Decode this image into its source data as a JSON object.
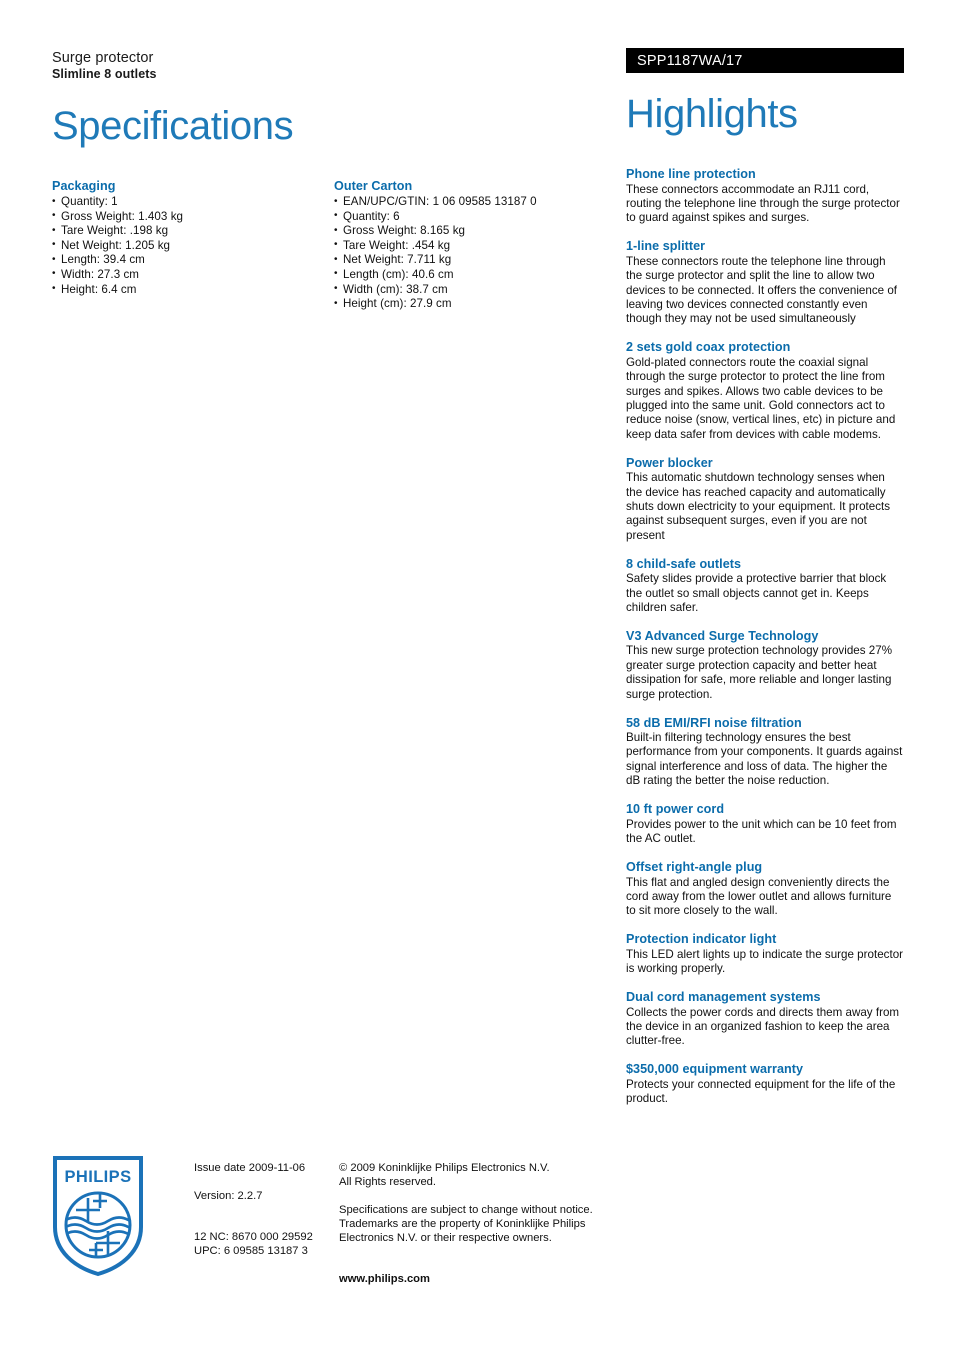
{
  "header": {
    "product_name": "Surge protector",
    "product_sub": "Slimline 8 outlets",
    "product_code": "SPP1187WA/17",
    "spec_title": "Specifications",
    "highlights_title": "Highlights"
  },
  "specifications": {
    "groups": [
      {
        "heading": "Packaging",
        "items": [
          "Quantity: 1",
          "Gross Weight: 1.403 kg",
          "Tare Weight: .198 kg",
          "Net Weight: 1.205 kg",
          "Length: 39.4 cm",
          "Width: 27.3 cm",
          "Height: 6.4 cm"
        ]
      },
      {
        "heading": "Outer Carton",
        "items": [
          "EAN/UPC/GTIN: 1 06 09585 13187 0",
          "Quantity: 6",
          "Gross Weight: 8.165 kg",
          "Tare Weight: .454 kg",
          "Net Weight: 7.711 kg",
          "Length (cm): 40.6 cm",
          "Width (cm): 38.7 cm",
          "Height (cm): 27.9 cm"
        ]
      }
    ]
  },
  "highlights": {
    "items": [
      {
        "heading": "Phone line protection",
        "body": "These connectors accommodate an RJ11 cord, routing the telephone line through the surge protector to guard against spikes and surges."
      },
      {
        "heading": "1-line splitter",
        "body": "These connectors route the telephone line through the surge protector and split the line to allow two devices to be connected. It offers the convenience of leaving two devices connected constantly even though they may not be used simultaneously"
      },
      {
        "heading": "2 sets gold coax protection",
        "body": "Gold-plated connectors route the coaxial signal through the surge protector to protect the line from surges and spikes. Allows two cable devices to be plugged into the same unit. Gold connectors act to reduce noise (snow, vertical lines, etc) in picture and keep data safer from devices with cable modems."
      },
      {
        "heading": "Power blocker",
        "body": "This automatic shutdown technology senses when the device has reached capacity and automatically shuts down electricity to your equipment. It protects against subsequent surges, even if you are not present"
      },
      {
        "heading": "8 child-safe outlets",
        "body": "Safety slides provide a protective barrier that block the outlet so small objects cannot get in. Keeps children safer."
      },
      {
        "heading": "V3 Advanced Surge Technology",
        "body": "This new surge protection technology provides 27% greater surge protection capacity and better heat dissipation for safe, more reliable and longer lasting surge protection."
      },
      {
        "heading": "58 dB EMI/RFI noise filtration",
        "body": "Built-in filtering technology ensures the best performance from your components. It guards against signal interference and loss of data. The higher the dB rating the better the noise reduction."
      },
      {
        "heading": "10 ft power cord",
        "body": "Provides power to the unit which can be 10 feet from the AC outlet."
      },
      {
        "heading": "Offset right-angle plug",
        "body": "This flat and angled design conveniently directs the cord away from the lower outlet and allows furniture to sit more closely to the wall."
      },
      {
        "heading": "Protection indicator light",
        "body": "This LED alert lights up to indicate the surge protector is working properly."
      },
      {
        "heading": "Dual cord management systems",
        "body": "Collects the power cords and directs them away from the device in an organized fashion to keep the area clutter-free."
      },
      {
        "heading": "$350,000 equipment warranty",
        "body": "Protects your connected equipment for the life of the product."
      }
    ]
  },
  "footer": {
    "logo_wordmark": "PHILIPS",
    "issue_date": "Issue date 2009-11-06",
    "version": "Version: 2.2.7",
    "twelve_nc": "12 NC: 8670 000 29592",
    "upc": "UPC: 6 09585 13187 3",
    "copyright_line1": "© 2009 Koninklijke Philips Electronics N.V.",
    "copyright_line2": "All Rights reserved.",
    "disclaimer_line1": "Specifications are subject to change without notice.",
    "disclaimer_line2": "Trademarks are the property of Koninklijke Philips",
    "disclaimer_line3": "Electronics N.V. or their respective owners.",
    "website": "www.philips.com"
  },
  "colors": {
    "heading_blue": "#0b6cab",
    "title_blue": "#1f7ab8",
    "code_bar_bg": "#000000",
    "logo_blue": "#1b72b8"
  }
}
